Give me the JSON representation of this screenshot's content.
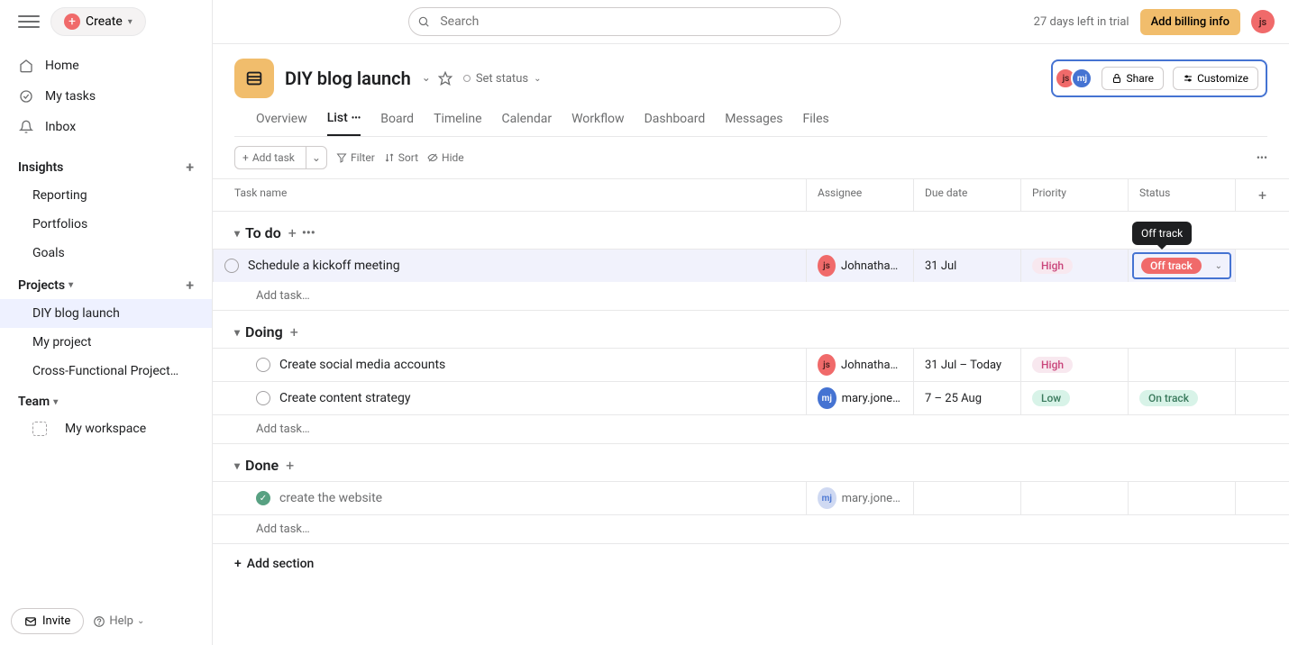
{
  "topbar": {
    "create_label": "Create",
    "search_placeholder": "Search",
    "trial_text": "27 days left in trial",
    "billing_label": "Add billing info",
    "user_initials": "js"
  },
  "sidebar": {
    "main_nav": [
      {
        "label": "Home",
        "icon": "home"
      },
      {
        "label": "My tasks",
        "icon": "check-circle"
      },
      {
        "label": "Inbox",
        "icon": "bell"
      }
    ],
    "insights_label": "Insights",
    "insights_items": [
      {
        "label": "Reporting"
      },
      {
        "label": "Portfolios"
      },
      {
        "label": "Goals"
      }
    ],
    "projects_label": "Projects",
    "projects_items": [
      {
        "label": "DIY blog launch",
        "active": true
      },
      {
        "label": "My project"
      },
      {
        "label": "Cross-Functional Project…"
      }
    ],
    "team_label": "Team",
    "team_items": [
      {
        "label": "My workspace"
      }
    ]
  },
  "project": {
    "title": "DIY blog launch",
    "set_status_label": "Set status",
    "share_label": "Share",
    "customize_label": "Customize",
    "avatars": [
      "js",
      "mj"
    ]
  },
  "tabs": [
    {
      "label": "Overview"
    },
    {
      "label": "List",
      "active": true
    },
    {
      "label": "Board"
    },
    {
      "label": "Timeline"
    },
    {
      "label": "Calendar"
    },
    {
      "label": "Workflow"
    },
    {
      "label": "Dashboard"
    },
    {
      "label": "Messages"
    },
    {
      "label": "Files"
    }
  ],
  "toolbar": {
    "add_task_label": "Add task",
    "filter_label": "Filter",
    "sort_label": "Sort",
    "hide_label": "Hide"
  },
  "columns": {
    "task_name": "Task name",
    "assignee": "Assignee",
    "due_date": "Due date",
    "priority": "Priority",
    "status": "Status"
  },
  "sections": [
    {
      "name": "To do",
      "tasks": [
        {
          "name": "Schedule a kickoff meeting",
          "assignee_initials": "js",
          "assignee_name": "Johnathan S…",
          "due": "31 Jul",
          "priority": "High",
          "status": "Off track",
          "selected": true
        }
      ],
      "add_label": "Add task…"
    },
    {
      "name": "Doing",
      "tasks": [
        {
          "name": "Create social media accounts",
          "assignee_initials": "js",
          "assignee_name": "Johnathan S…",
          "due": "31 Jul – Today",
          "priority": "High",
          "status": ""
        },
        {
          "name": "Create content strategy",
          "assignee_initials": "mj",
          "assignee_name": "mary.joness…",
          "due": "7 – 25 Aug",
          "priority": "Low",
          "status": "On track"
        }
      ],
      "add_label": "Add task…"
    },
    {
      "name": "Done",
      "tasks": [
        {
          "name": "create the website",
          "assignee_initials": "mj",
          "assignee_name": "mary.joness…",
          "due": "",
          "priority": "",
          "status": "",
          "done": true,
          "light_avatar": true
        }
      ],
      "add_label": "Add task…"
    }
  ],
  "add_section_label": "Add section",
  "tooltip_text": "Off track",
  "bottom": {
    "invite_label": "Invite",
    "help_label": "Help"
  }
}
